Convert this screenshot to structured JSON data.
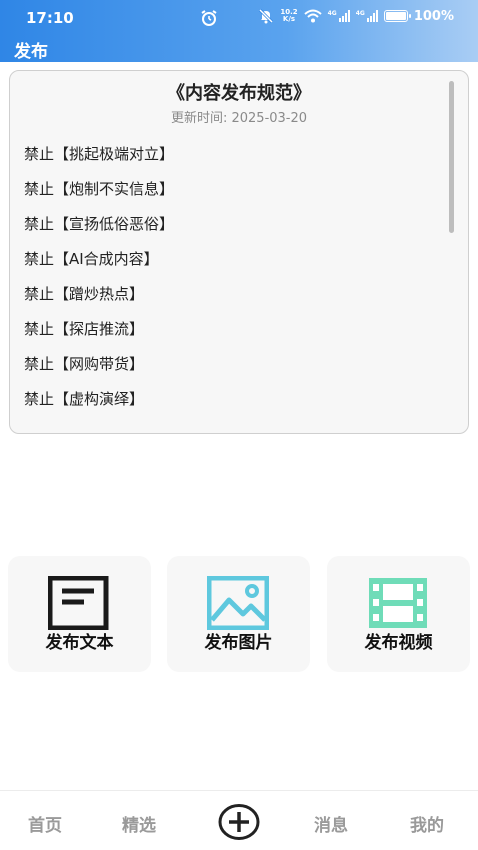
{
  "status_bar": {
    "time": "17:10",
    "net_speed_top": "10.2",
    "net_speed_bottom": "K/s",
    "sig1_label": "4G",
    "sig2_label": "4G",
    "battery": "100%"
  },
  "header": {
    "title": "发布"
  },
  "rules": {
    "title": "《内容发布规范》",
    "updated": "更新时间: 2025-03-20",
    "items": [
      "禁止【挑起极端对立】",
      "禁止【炮制不实信息】",
      "禁止【宣扬低俗恶俗】",
      "禁止【AI合成内容】",
      "禁止【蹭炒热点】",
      "禁止【探店推流】",
      "禁止【网购带货】",
      "禁止【虚构演绎】"
    ]
  },
  "actions": {
    "text": {
      "label": "发布文本",
      "icon": "document-icon",
      "color": "#1a1a1a"
    },
    "image": {
      "label": "发布图片",
      "icon": "image-icon",
      "color": "#5ec8de"
    },
    "video": {
      "label": "发布视频",
      "icon": "film-icon",
      "color": "#6fdcb8"
    }
  },
  "nav": {
    "home": "首页",
    "featured": "精选",
    "add_icon": "plus-circle-icon",
    "messages": "消息",
    "mine": "我的"
  }
}
